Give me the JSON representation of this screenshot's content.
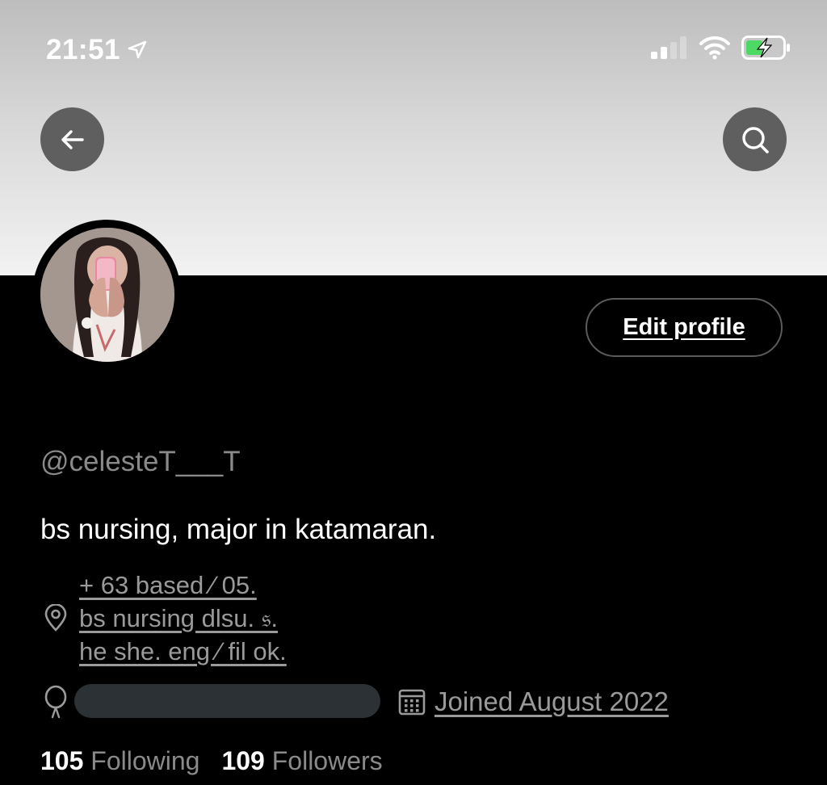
{
  "status_bar": {
    "time": "21:51",
    "icons": [
      "location-arrow-icon",
      "cellular-signal-icon",
      "wifi-icon",
      "battery-charging-icon"
    ]
  },
  "header": {
    "back_icon": "arrow-left-icon",
    "search_icon": "search-icon"
  },
  "profile": {
    "edit_button_label": "Edit profile",
    "handle": "@celesteT___T",
    "bio": "bs nursing, major in katamaran.",
    "location_lines": [
      "+ 63 based  ∕  05.",
      "bs nursing dlsu. 𝔰.",
      "he she. eng ∕ fil ok."
    ],
    "joined": "Joined August 2022",
    "following_count": "105",
    "following_label": "Following",
    "followers_count": "109",
    "followers_label": "Followers"
  },
  "colors": {
    "background": "#000000",
    "muted_text": "#8a8a8a",
    "battery_green": "#4cd964",
    "button_bg": "#5f5f5f"
  }
}
